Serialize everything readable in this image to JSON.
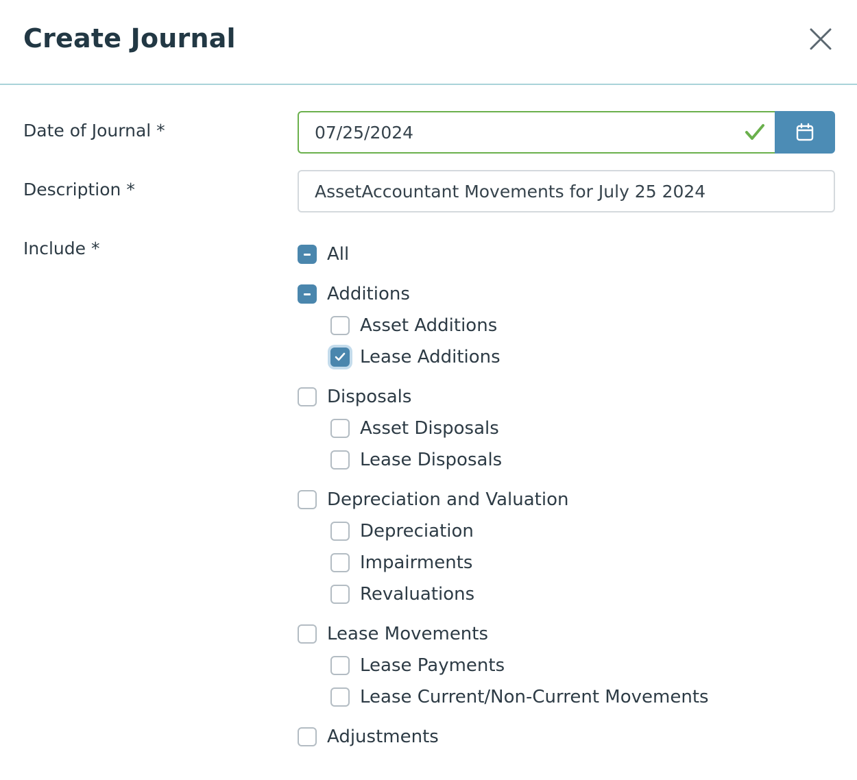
{
  "dialog": {
    "title": "Create Journal",
    "close_icon": "close-icon"
  },
  "form": {
    "date_label": "Date of Journal *",
    "date_value": "07/25/2024",
    "date_valid_icon": "checkmark-icon",
    "calendar_icon": "calendar-icon",
    "description_label": "Description *",
    "description_value": "AssetAccountant Movements for July 25 2024",
    "include_label": "Include *"
  },
  "colors": {
    "accent": "#4a86ad",
    "valid_green": "#6ab04c",
    "divider": "#a9d3d9"
  },
  "include_options": [
    {
      "label": "All",
      "state": "indeterminate"
    },
    {
      "label": "Additions",
      "state": "indeterminate"
    },
    {
      "label": "Asset Additions",
      "state": "unchecked"
    },
    {
      "label": "Lease Additions",
      "state": "checked",
      "focused": true
    },
    {
      "label": "Disposals",
      "state": "unchecked"
    },
    {
      "label": "Asset Disposals",
      "state": "unchecked"
    },
    {
      "label": "Lease Disposals",
      "state": "unchecked"
    },
    {
      "label": "Depreciation and Valuation",
      "state": "unchecked"
    },
    {
      "label": "Depreciation",
      "state": "unchecked"
    },
    {
      "label": "Impairments",
      "state": "unchecked"
    },
    {
      "label": "Revaluations",
      "state": "unchecked"
    },
    {
      "label": "Lease Movements",
      "state": "unchecked"
    },
    {
      "label": "Lease Payments",
      "state": "unchecked"
    },
    {
      "label": "Lease Current/Non-Current Movements",
      "state": "unchecked"
    },
    {
      "label": "Adjustments",
      "state": "unchecked"
    }
  ]
}
